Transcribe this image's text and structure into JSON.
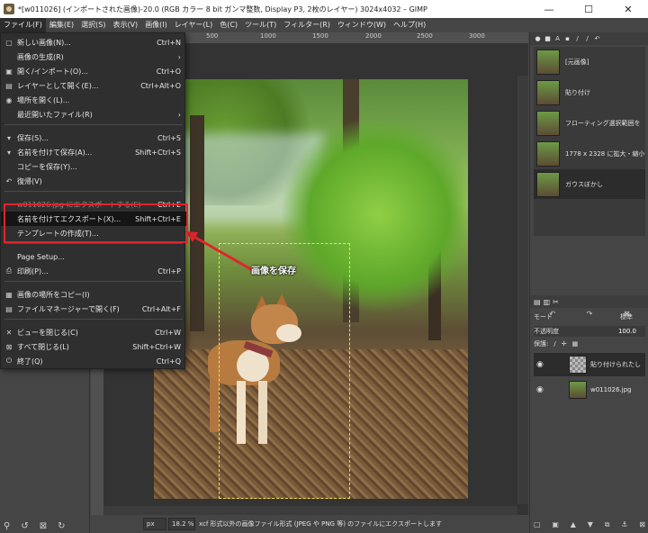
{
  "window": {
    "title": "*[w011026] (インポートされた画像)-20.0 (RGB カラー 8 bit ガンマ整数, Display P3, 2枚のレイヤー) 3024x4032 – GIMP",
    "minimize": "—",
    "maximize": "☐",
    "close": "✕"
  },
  "menubar": [
    "ファイル(F)",
    "編集(E)",
    "選択(S)",
    "表示(V)",
    "画像(I)",
    "レイヤー(L)",
    "色(C)",
    "ツール(T)",
    "フィルター(R)",
    "ウィンドウ(W)",
    "ヘルプ(H)"
  ],
  "file_menu": {
    "items": [
      {
        "icon": "▢",
        "label": "新しい画像(N)...",
        "shortcut": "Ctrl+N"
      },
      {
        "icon": "",
        "label": "画像の生成(R)",
        "shortcut": "›"
      },
      {
        "icon": "▣",
        "label": "開く/インポート(O)...",
        "shortcut": "Ctrl+O"
      },
      {
        "icon": "▤",
        "label": "レイヤーとして開く(E)...",
        "shortcut": "Ctrl+Alt+O"
      },
      {
        "icon": "◉",
        "label": "場所を開く(L)...",
        "shortcut": ""
      },
      {
        "icon": "",
        "label": "最近開いたファイル(R)",
        "shortcut": "›"
      },
      {
        "icon": "▾",
        "label": "保存(S)...",
        "shortcut": "Ctrl+S"
      },
      {
        "icon": "▾",
        "label": "名前を付けて保存(A)...",
        "shortcut": "Shift+Ctrl+S"
      },
      {
        "icon": "",
        "label": "コピーを保存(Y)...",
        "shortcut": ""
      },
      {
        "icon": "↶",
        "label": "復帰(V)",
        "shortcut": ""
      },
      {
        "icon": "",
        "label": "w011026.jpg にエクスポートする(E)",
        "shortcut": "Ctrl+E"
      },
      {
        "icon": "",
        "label": "名前を付けてエクスポート(X)...",
        "shortcut": "Shift+Ctrl+E"
      },
      {
        "icon": "",
        "label": "テンプレートの作成(T)...",
        "shortcut": ""
      },
      {
        "icon": "",
        "label": "Page Setup...",
        "shortcut": ""
      },
      {
        "icon": "⎙",
        "label": "印刷(P)...",
        "shortcut": "Ctrl+P"
      },
      {
        "icon": "▦",
        "label": "画像の場所をコピー(I)",
        "shortcut": ""
      },
      {
        "icon": "▤",
        "label": "ファイルマネージャーで開く(F)",
        "shortcut": "Ctrl+Alt+F"
      },
      {
        "icon": "✕",
        "label": "ビューを閉じる(C)",
        "shortcut": "Ctrl+W"
      },
      {
        "icon": "⊠",
        "label": "すべて閉じる(L)",
        "shortcut": "Shift+Ctrl+W"
      },
      {
        "icon": "⏻",
        "label": "終了(Q)",
        "shortcut": "Ctrl+Q"
      }
    ]
  },
  "annotation": {
    "label": "画像を保存",
    "color": "#e0242c"
  },
  "ruler": {
    "ticks": [
      "500",
      "1000",
      "1500",
      "2000",
      "2500",
      "3000"
    ]
  },
  "history": {
    "items": [
      "[元画像]",
      "貼り付け",
      "フローティング選択範囲を",
      "1778 x 2328 に拡大・縮小",
      "ガウスぼかし"
    ]
  },
  "layers": {
    "mode_label": "モード",
    "mode_value": "標準",
    "opacity_label": "不透明度",
    "opacity_value": "100.0",
    "lock_label": "保護:",
    "items": [
      {
        "name": "貼り付けられたし"
      },
      {
        "name": "w011026.jpg"
      }
    ]
  },
  "statusbar": {
    "unit": "px",
    "zoom": "18.2 %",
    "message": "xcf 形式以外の画像ファイル形式 (JPEG や PNG 等) のファイルにエクスポートします"
  }
}
